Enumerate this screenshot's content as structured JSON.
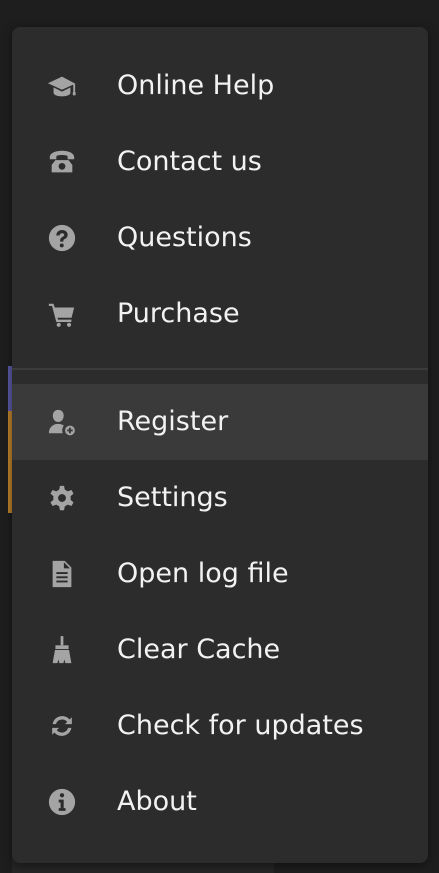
{
  "menu": {
    "top_group": [
      {
        "label": "Online Help",
        "icon": "graduation-cap-icon"
      },
      {
        "label": "Contact us",
        "icon": "telephone-icon"
      },
      {
        "label": "Questions",
        "icon": "question-circle-icon"
      },
      {
        "label": "Purchase",
        "icon": "shopping-cart-icon"
      }
    ],
    "bottom_group": [
      {
        "label": "Register",
        "icon": "user-add-icon",
        "state": "hover"
      },
      {
        "label": "Settings",
        "icon": "gear-icon"
      },
      {
        "label": "Open log file",
        "icon": "document-icon"
      },
      {
        "label": "Clear Cache",
        "icon": "broom-icon"
      },
      {
        "label": "Check for updates",
        "icon": "refresh-icon"
      },
      {
        "label": "About",
        "icon": "info-circle-icon"
      }
    ]
  },
  "colors": {
    "menu_background": "#2c2c2c",
    "hover_background": "#3a3a3a",
    "label_text": "#f2f2f2",
    "icon": "#a4a4a4",
    "edge_accent_purple": "#5c5aa8",
    "edge_accent_orange": "#c0842c"
  }
}
